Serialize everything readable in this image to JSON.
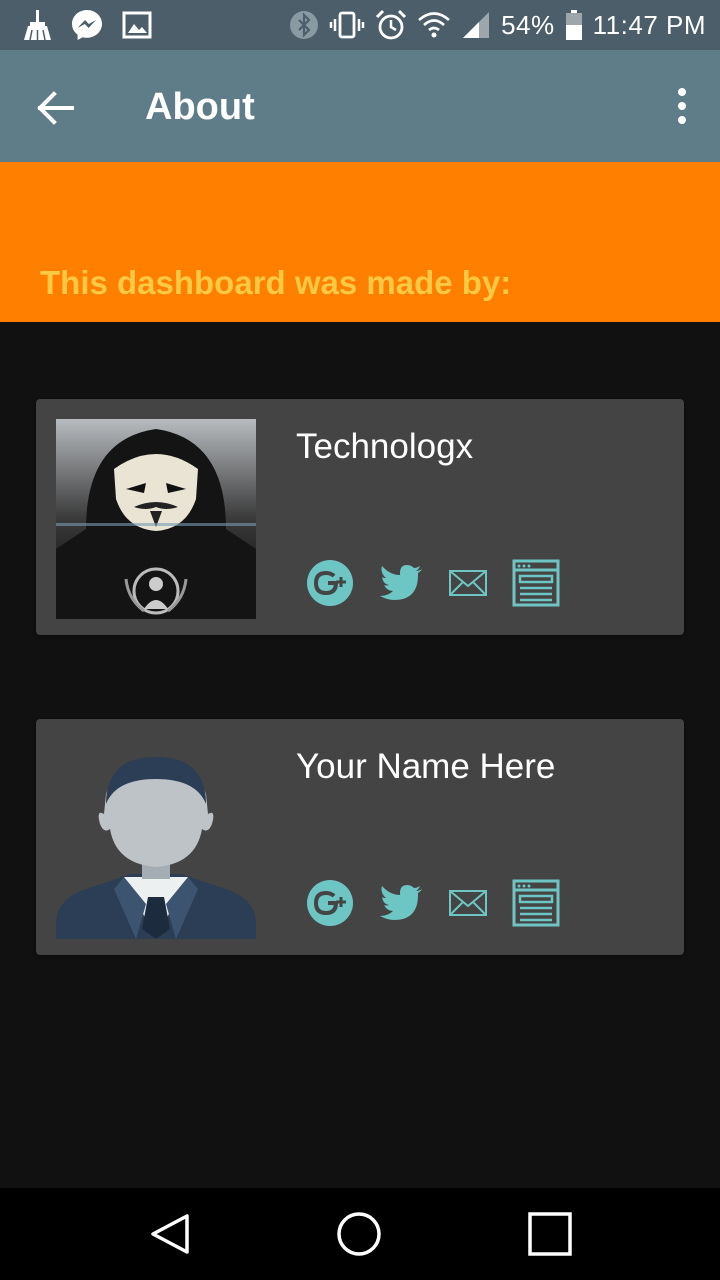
{
  "status_bar": {
    "battery_percent": "54%",
    "time": "11:47 PM",
    "left_icons": [
      "cleaner-icon",
      "messenger-icon",
      "gallery-icon"
    ],
    "right_icons": [
      "bluetooth-icon",
      "vibrate-icon",
      "alarm-icon",
      "wifi-icon",
      "signal-icon",
      "battery-icon"
    ]
  },
  "toolbar": {
    "title": "About",
    "back_icon": "arrow-back-icon",
    "menu_icon": "more-vert-icon"
  },
  "banner": {
    "text": "This dashboard was made by:"
  },
  "cards": [
    {
      "name": "Technologx",
      "avatar": "anonymous-hacker-avatar",
      "socials": [
        "google-plus-icon",
        "twitter-icon",
        "email-icon",
        "website-icon"
      ]
    },
    {
      "name": "Your Name Here",
      "avatar": "default-person-avatar",
      "socials": [
        "google-plus-icon",
        "twitter-icon",
        "email-icon",
        "website-icon"
      ]
    }
  ],
  "nav_bar": [
    "nav-back-icon",
    "nav-home-icon",
    "nav-recents-icon"
  ],
  "colors": {
    "status_bar": "#4b5e69",
    "toolbar": "#5f7c89",
    "banner": "#ff7f00",
    "banner_text": "#ffc942",
    "background": "#111111",
    "card": "#444444",
    "accent": "#6ec6c4"
  }
}
